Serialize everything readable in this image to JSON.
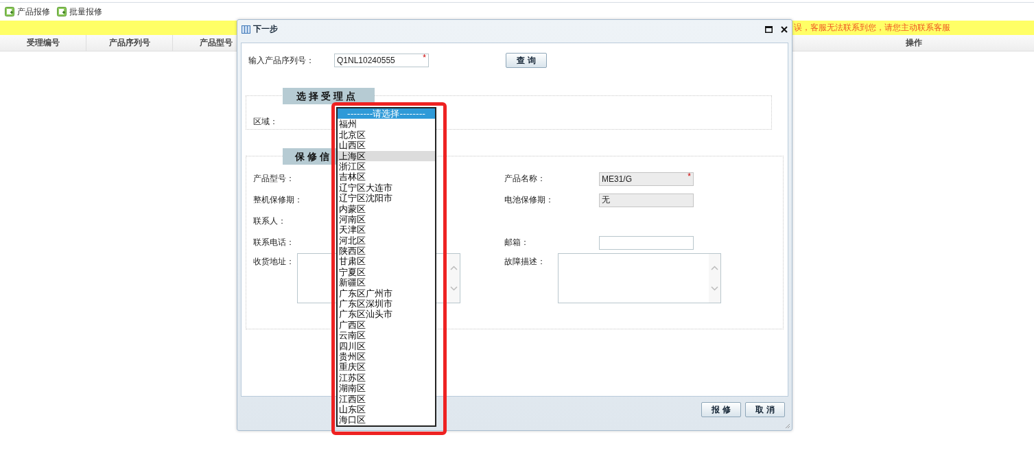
{
  "toolbar": [
    {
      "label": "产品报修"
    },
    {
      "label": "批量报修"
    }
  ],
  "notice": "误，客服无法联系到您，请您主动联系客服",
  "table": {
    "columns": [
      "受理编号",
      "产品序列号",
      "产品型号",
      "操作"
    ]
  },
  "dialog": {
    "title": "下一步",
    "serial": {
      "label": "输入产品序列号：",
      "value": "Q1NL10240555",
      "required_mark": "*"
    },
    "query_button": "查 询",
    "sections": [
      {
        "title": "选择受理点",
        "rows": [
          {
            "left": {
              "kind": "label",
              "label": "区域："
            }
          }
        ]
      },
      {
        "title": "保修信",
        "rows": [
          {
            "left": {
              "kind": "label",
              "label": "产品型号："
            },
            "right": {
              "kind": "input",
              "label": "产品名称：",
              "value": "ME31/G",
              "readonly": true,
              "required_mark": "*"
            }
          },
          {
            "left": {
              "kind": "label",
              "label": "整机保修期："
            },
            "right": {
              "kind": "input",
              "label": "电池保修期：",
              "value": "无",
              "readonly": true
            }
          },
          {
            "left": {
              "kind": "label",
              "label": "联系人："
            }
          },
          {
            "left": {
              "kind": "label",
              "label": "联系电话："
            },
            "right": {
              "kind": "input",
              "label": "邮箱：",
              "readonly": false
            }
          },
          {
            "left": {
              "kind": "textarea",
              "label": "收货地址："
            },
            "right": {
              "kind": "textarea",
              "label": "故障描述："
            }
          }
        ]
      }
    ],
    "buttons": [
      "报 修",
      "取 消"
    ]
  },
  "dropdown": {
    "options": [
      {
        "label": "--------请选择--------",
        "selected": true,
        "hovered": false
      },
      {
        "label": "福州",
        "selected": false,
        "hovered": false
      },
      {
        "label": "北京区",
        "selected": false,
        "hovered": false
      },
      {
        "label": "山西区",
        "selected": false,
        "hovered": false
      },
      {
        "label": "上海区",
        "selected": false,
        "hovered": true
      },
      {
        "label": "浙江区",
        "selected": false,
        "hovered": false
      },
      {
        "label": "吉林区",
        "selected": false,
        "hovered": false
      },
      {
        "label": "辽宁区大连市",
        "selected": false,
        "hovered": false
      },
      {
        "label": "辽宁区沈阳市",
        "selected": false,
        "hovered": false
      },
      {
        "label": "内蒙区",
        "selected": false,
        "hovered": false
      },
      {
        "label": "河南区",
        "selected": false,
        "hovered": false
      },
      {
        "label": "天津区",
        "selected": false,
        "hovered": false
      },
      {
        "label": "河北区",
        "selected": false,
        "hovered": false
      },
      {
        "label": "陕西区",
        "selected": false,
        "hovered": false
      },
      {
        "label": "甘肃区",
        "selected": false,
        "hovered": false
      },
      {
        "label": "宁夏区",
        "selected": false,
        "hovered": false
      },
      {
        "label": "新疆区",
        "selected": false,
        "hovered": false
      },
      {
        "label": "广东区广州市",
        "selected": false,
        "hovered": false
      },
      {
        "label": "广东区深圳市",
        "selected": false,
        "hovered": false
      },
      {
        "label": "广东区汕头市",
        "selected": false,
        "hovered": false
      },
      {
        "label": "广西区",
        "selected": false,
        "hovered": false
      },
      {
        "label": "云南区",
        "selected": false,
        "hovered": false
      },
      {
        "label": "四川区",
        "selected": false,
        "hovered": false
      },
      {
        "label": "贵州区",
        "selected": false,
        "hovered": false
      },
      {
        "label": "重庆区",
        "selected": false,
        "hovered": false
      },
      {
        "label": "江苏区",
        "selected": false,
        "hovered": false
      },
      {
        "label": "湖南区",
        "selected": false,
        "hovered": false
      },
      {
        "label": "江西区",
        "selected": false,
        "hovered": false
      },
      {
        "label": "山东区",
        "selected": false,
        "hovered": false
      },
      {
        "label": "海口区",
        "selected": false,
        "hovered": false
      }
    ]
  }
}
